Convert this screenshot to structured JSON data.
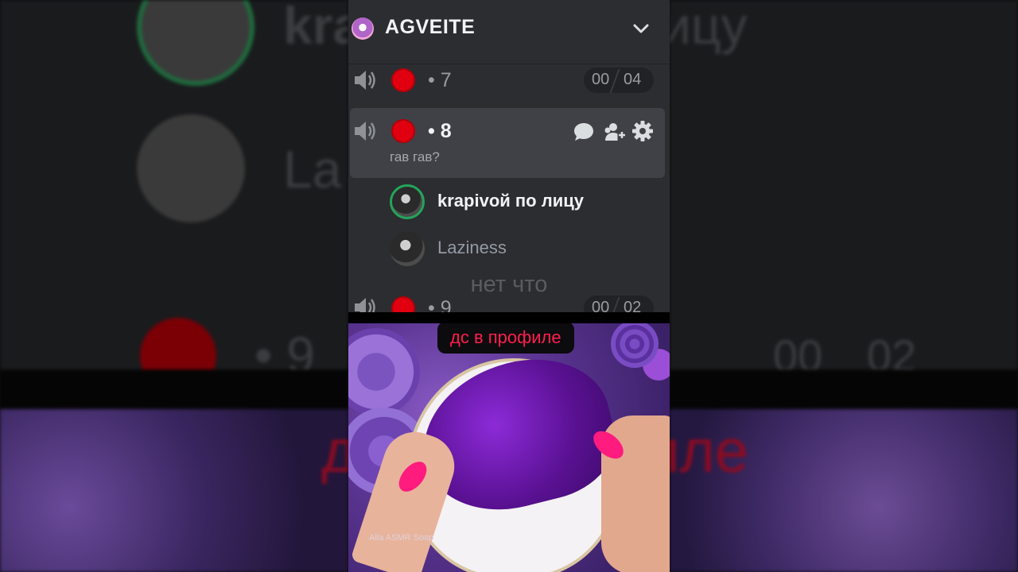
{
  "server": {
    "name": "AGVEITE",
    "icon": "server-flower-icon"
  },
  "channels": [
    {
      "name": "• 7",
      "counter_left": "00",
      "counter_right": "04"
    },
    {
      "name": "• 8",
      "status": "гав гав?"
    },
    {
      "name": "• 9",
      "counter_left": "00",
      "counter_right": "02"
    }
  ],
  "members": [
    {
      "name": "krapivой по лицу",
      "speaking": true
    },
    {
      "name": "Laziness",
      "speaking": false
    }
  ],
  "captions": {
    "overlay": "нет что",
    "video_subtitle": "дс в профиле"
  },
  "video": {
    "watermark": "Alla ASMR Soap"
  },
  "background": {
    "left_name_1": "kra",
    "left_name_2": "La",
    "left_nine": "• 9",
    "right_name_1": "ицу",
    "right_counter_left": "00",
    "right_counter_right": "02",
    "left_sub": "д",
    "right_sub": "иле"
  },
  "colors": {
    "panel_bg": "#2b2d31",
    "active_row": "#3f4147",
    "speaking_ring": "#23a55a",
    "record_red": "#e00010",
    "subtitle_red": "#ff1f4d"
  }
}
